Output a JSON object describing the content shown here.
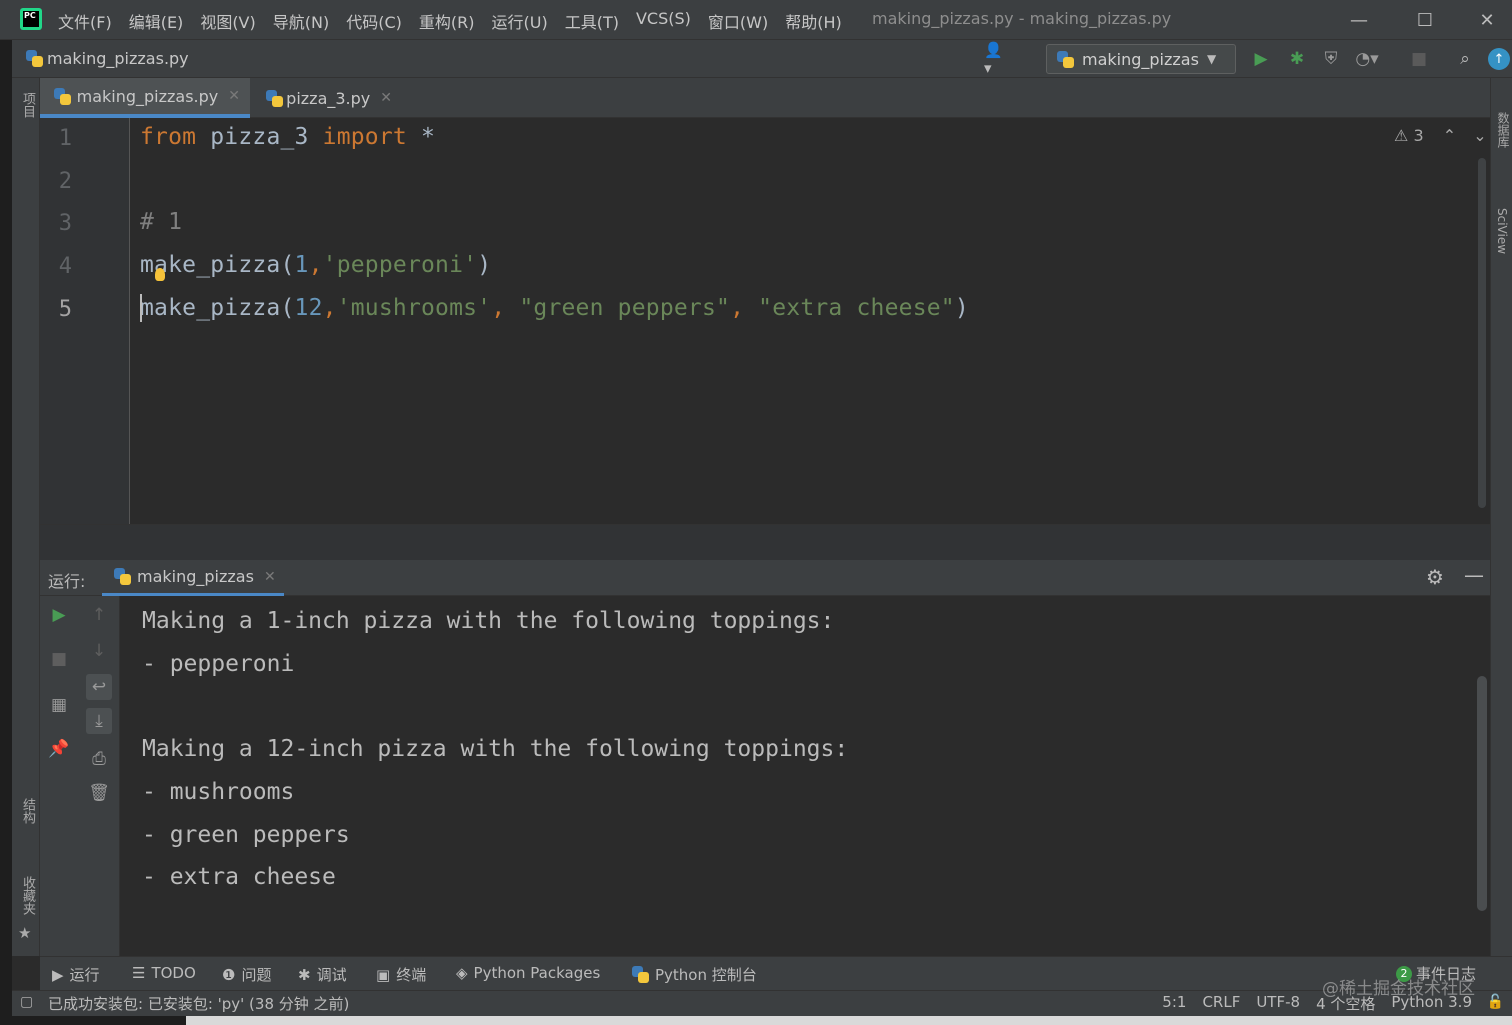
{
  "window": {
    "title": "making_pizzas.py - making_pizzas.py",
    "app_logo_text": "PC",
    "controls": {
      "minimize": "—",
      "maximize": "☐",
      "close": "✕"
    }
  },
  "menu": [
    "文件(F)",
    "编辑(E)",
    "视图(V)",
    "导航(N)",
    "代码(C)",
    "重构(R)",
    "运行(U)",
    "工具(T)",
    "VCS(S)",
    "窗口(W)",
    "帮助(H)"
  ],
  "navbar": {
    "breadcrumb_file": "making_pizzas.py",
    "run_configuration": "making_pizzas"
  },
  "left_toolwindows": {
    "project": "项目",
    "structure": "结构",
    "favorites": "收藏夹"
  },
  "right_toolwindows": {
    "database": "数据库",
    "sciview": "SciView"
  },
  "tabs": [
    {
      "label": "making_pizzas.py",
      "active": true
    },
    {
      "label": "pizza_3.py",
      "active": false
    }
  ],
  "editor": {
    "line_numbers": [
      "1",
      "2",
      "3",
      "4",
      "5"
    ],
    "lines": {
      "l1": {
        "kw_from": "from",
        "module": " pizza_3 ",
        "kw_import": "import",
        "star": " *"
      },
      "l3": {
        "comment": "# 1"
      },
      "l4": {
        "fn": "make_pizza(",
        "arg1": "1",
        "comma": ",",
        "arg2": "'pepperoni'",
        "close": ")"
      },
      "l5": {
        "fn": "make_pizza(",
        "arg1": "12",
        "comma1": ",",
        "arg2": "'mushrooms'",
        "comma2": ", ",
        "arg3": "\"green peppers\"",
        "comma3": ", ",
        "arg4": "\"extra cheese\"",
        "close": ")"
      }
    },
    "inspection_count": "3"
  },
  "run_panel": {
    "label": "运行:",
    "tab": "making_pizzas",
    "output": [
      "Making a 1-inch pizza with the following toppings:",
      "- pepperoni",
      "",
      "Making a 12-inch pizza with the following toppings:",
      "- mushrooms",
      "- green peppers",
      "- extra cheese"
    ]
  },
  "bottom_tabs": [
    "运行",
    "TODO",
    "问题",
    "调试",
    "终端",
    "Python Packages",
    "Python 控制台"
  ],
  "event_log": {
    "count": "2",
    "label": "事件日志"
  },
  "status": {
    "message": "已成功安装包: 已安装包: 'py' (38 分钟 之前)",
    "position": "5:1",
    "line_separator": "CRLF",
    "encoding": "UTF-8",
    "indent": "4 个空格",
    "interpreter": "Python 3.9"
  },
  "watermark": "@稀土掘金技术社区",
  "colors": {
    "keyword": "#cc7832",
    "number": "#6897bb",
    "string": "#6a8759",
    "comment": "#808080",
    "accent": "#4a88c7",
    "run_green": "#499c54"
  }
}
